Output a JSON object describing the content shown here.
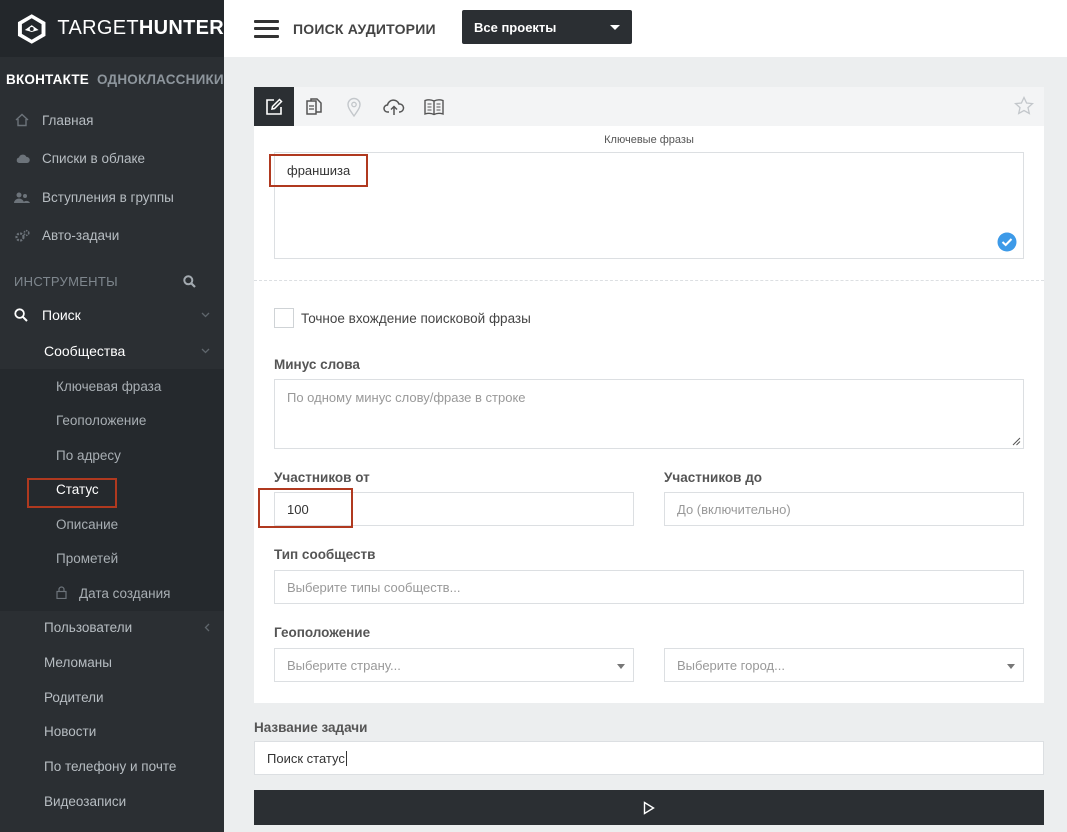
{
  "brand": {
    "name_light": "TARGET",
    "name_bold": "HUNTER"
  },
  "networks": {
    "active": "ВКОНТАКТЕ",
    "other": "ОДНОКЛАССНИКИ"
  },
  "nav": [
    {
      "label": "Главная",
      "icon": "home-icon"
    },
    {
      "label": "Списки в облаке",
      "icon": "cloud-icon"
    },
    {
      "label": "Вступления в группы",
      "icon": "users-icon"
    },
    {
      "label": "Авто-задачи",
      "icon": "gears-icon"
    }
  ],
  "tools": {
    "heading": "ИНСТРУМЕНТЫ",
    "search": "Поиск",
    "communities": "Сообщества"
  },
  "communities_items": [
    "Ключевая фраза",
    "Геоположение",
    "По адресу",
    "Статус",
    "Описание",
    "Прометей",
    "Дата создания"
  ],
  "search_items": [
    "Пользователи",
    "Меломаны",
    "Родители",
    "Новости",
    "По телефону и почте",
    "Видеозаписи"
  ],
  "topbar": {
    "title": "ПОИСК АУДИТОРИИ",
    "projects": "Все проекты"
  },
  "form": {
    "keywords_label": "Ключевые фразы",
    "keywords_value": "франшиза",
    "exact_match_label": "Точное вхождение поисковой фразы",
    "minus_label": "Минус слова",
    "minus_placeholder": "По одному минус слову/фразе в строке",
    "members_from_label": "Участников от",
    "members_from_value": "100",
    "members_to_label": "Участников до",
    "members_to_placeholder": "До (включительно)",
    "type_label": "Тип сообществ",
    "type_placeholder": "Выберите типы сообществ...",
    "geo_label": "Геоположение",
    "country_placeholder": "Выберите страну...",
    "city_placeholder": "Выберите город...",
    "task_label": "Название задачи",
    "task_value": "Поиск статус"
  },
  "colors": {
    "sidebar": "#2b2f33",
    "highlight": "#b0391f",
    "accent": "#3d9ae8"
  }
}
